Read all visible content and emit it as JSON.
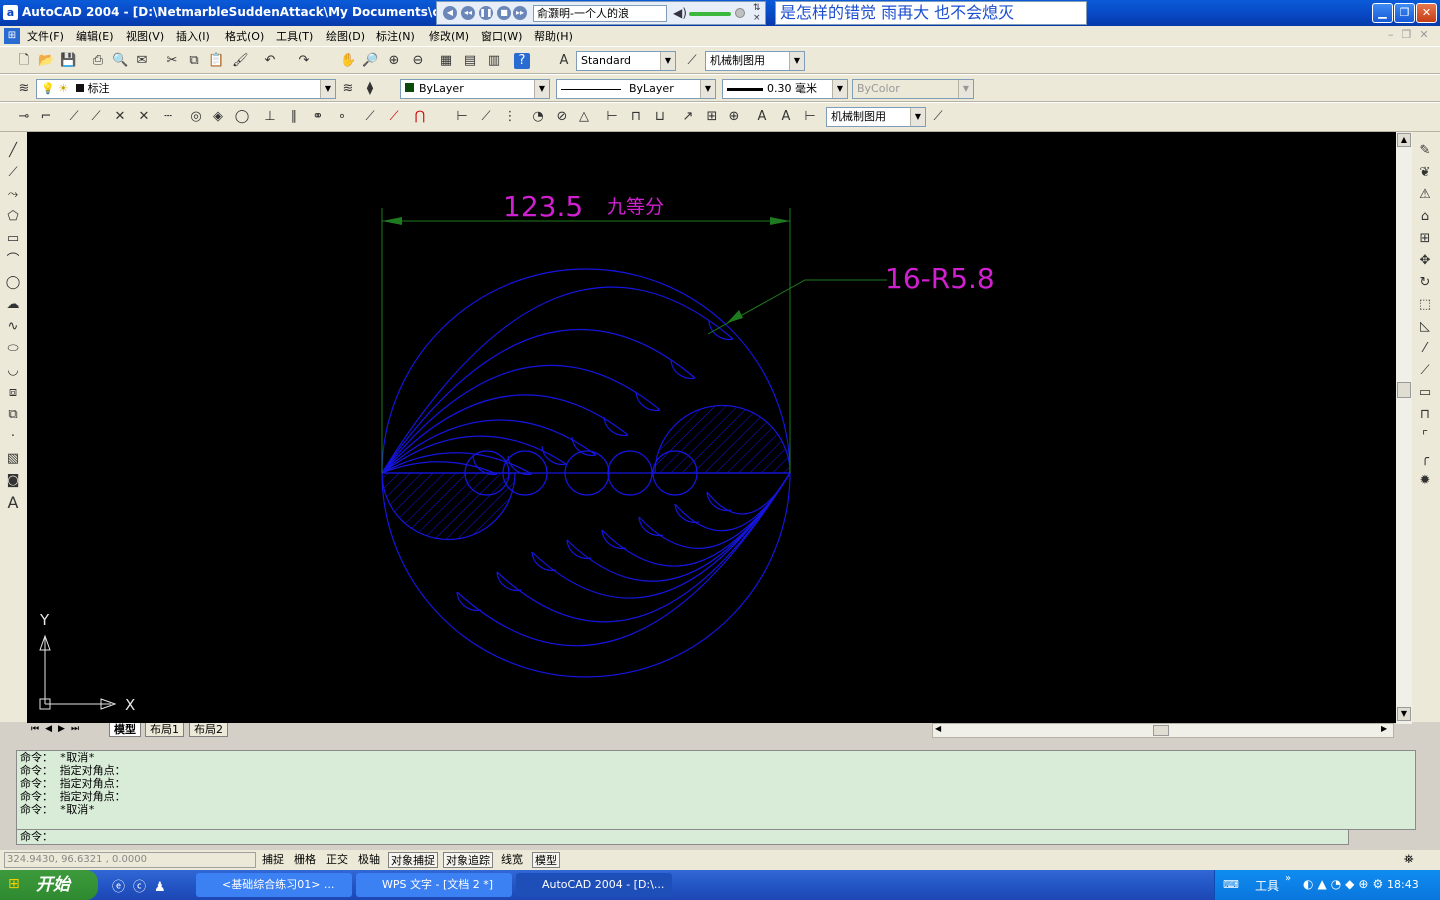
{
  "window": {
    "title": "AutoCAD 2004 - [D:\\NetmarbleSuddenAttack\\My Documents\\cad",
    "app_icon": "a"
  },
  "player": {
    "song": "俞灏明-一个人的浪",
    "lyric": "是怎样的错觉    雨再大  也不会熄灭"
  },
  "menu": [
    "文件(F)",
    "编辑(E)",
    "视图(V)",
    "插入(I)",
    "格式(O)",
    "工具(T)",
    "绘图(D)",
    "标注(N)",
    "修改(M)",
    "窗口(W)",
    "帮助(H)"
  ],
  "toolbars": {
    "text_style": "Standard",
    "dim_style": "机械制图用",
    "layer": "标注",
    "color": "ByLayer",
    "linetype": "ByLayer",
    "lineweight": "0.30 毫米",
    "plotstyle": "ByColor",
    "dim_style2": "机械制图用"
  },
  "drawing": {
    "dimension_text": "123.5",
    "dimension_note": "九等分",
    "leader_text": "16-R5.8",
    "ucs_x": "X",
    "ucs_y": "Y",
    "colors": {
      "geometry": "#1515e0",
      "dimension": "#1e7a1e",
      "text": "#d020d0"
    }
  },
  "layout_tabs": [
    "模型",
    "布局1",
    "布局2"
  ],
  "command_history": [
    "命令： *取消*",
    "命令： 指定对角点：",
    "命令： 指定对角点：",
    "命令： 指定对角点：",
    "命令： *取消*"
  ],
  "command_prompt": "命令：",
  "status": {
    "coords": "324.9430,  96.6321 ,  0.0000",
    "buttons": [
      "捕捉",
      "栅格",
      "正交",
      "极轴",
      "对象捕捉",
      "对象追踪",
      "线宽",
      "模型"
    ]
  },
  "taskbar": {
    "start": "开始",
    "tasks": [
      "<基础综合练习01> ...",
      "WPS 文字 - [文档 2 *]",
      "AutoCAD 2004 - [D:\\..."
    ],
    "tray_label": "工具",
    "clock": "18:43"
  }
}
